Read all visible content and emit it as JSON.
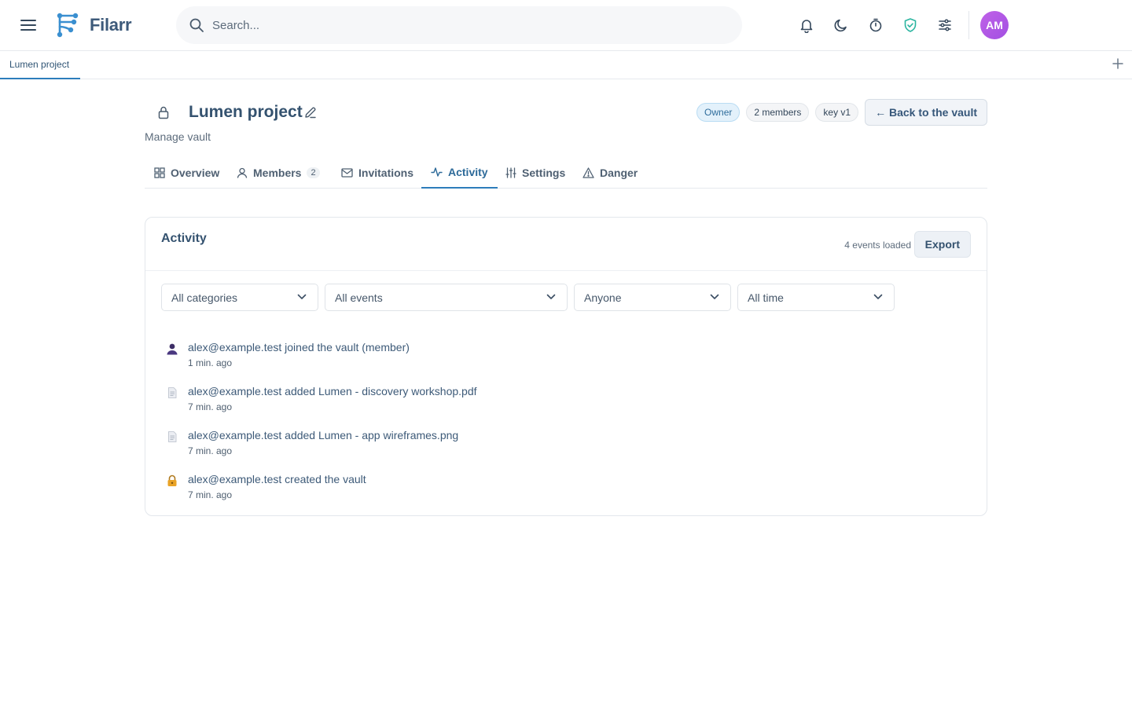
{
  "app": {
    "name": "Filarr"
  },
  "search": {
    "placeholder": "Search..."
  },
  "user": {
    "initials": "AM"
  },
  "colors": {
    "accent": "#2d7dbb",
    "shield": "#2bb5a0",
    "avatar": "#b45ae6"
  },
  "open_tabs": [
    {
      "label": "Lumen project"
    }
  ],
  "vault": {
    "title": "Lumen project",
    "subtitle": "Manage vault",
    "badges": {
      "role": "Owner",
      "members": "2 members",
      "key": "key v1"
    },
    "back_label": "← Back to the vault"
  },
  "tabs": [
    {
      "label": "Overview",
      "icon": "grid-icon"
    },
    {
      "label": "Members",
      "icon": "user-icon",
      "count": "2"
    },
    {
      "label": "Invitations",
      "icon": "mail-icon"
    },
    {
      "label": "Activity",
      "icon": "activity-icon",
      "active": true
    },
    {
      "label": "Settings",
      "icon": "sliders-icon"
    },
    {
      "label": "Danger",
      "icon": "warning-icon"
    }
  ],
  "activity": {
    "title": "Activity",
    "events_loaded": "4 events loaded",
    "export_label": "Export",
    "filters": {
      "category": "All categories",
      "event": "All events",
      "actor": "Anyone",
      "time": "All time"
    },
    "events": [
      {
        "text": "alex@example.test joined the vault (member)",
        "time": "1 min. ago",
        "icon": "user-joined-icon"
      },
      {
        "text": "alex@example.test added Lumen - discovery workshop.pdf",
        "time": "7 min. ago",
        "icon": "document-icon"
      },
      {
        "text": "alex@example.test added Lumen - app wireframes.png",
        "time": "7 min. ago",
        "icon": "document-icon"
      },
      {
        "text": "alex@example.test created the vault",
        "time": "7 min. ago",
        "icon": "padlock-icon"
      }
    ]
  }
}
